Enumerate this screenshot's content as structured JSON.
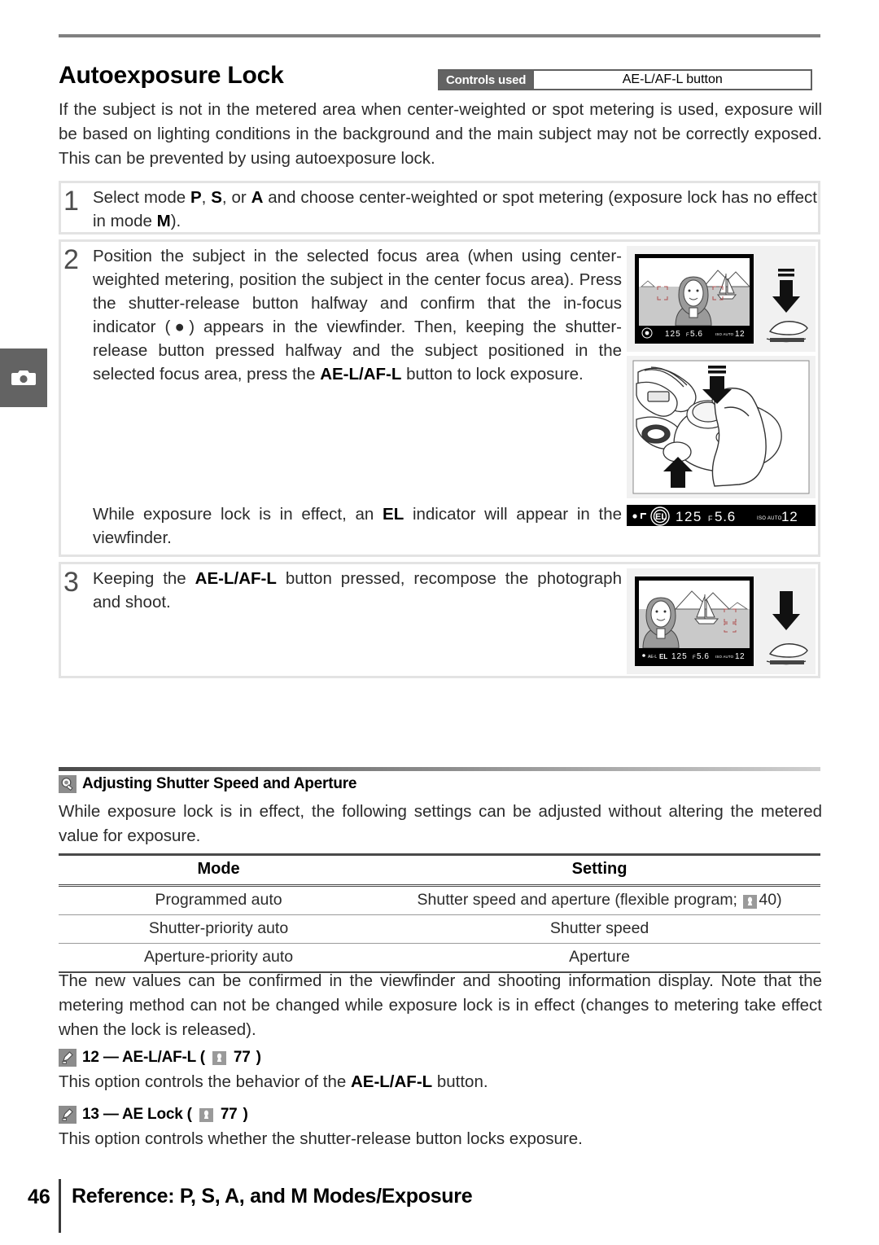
{
  "page": {
    "number": "46",
    "footer_title": "Reference: P, S, A, and M Modes/Exposure",
    "tab_icon": "camera-icon"
  },
  "header": {
    "title": "Autoexposure Lock",
    "controls_used_label": "Controls used",
    "controls_used_value": "AE-L/AF-L button"
  },
  "intro": "If the subject is not in the metered area when center-weighted or spot metering is used, exposure will be based on lighting conditions in the background and the main subject may not be correctly exposed.  This can be prevented by using autoexposure lock.",
  "steps": [
    {
      "number": "1",
      "text_parts": [
        {
          "t": "Select mode ",
          "b": false
        },
        {
          "t": "P",
          "b": true
        },
        {
          "t": ", ",
          "b": false
        },
        {
          "t": "S",
          "b": true
        },
        {
          "t": ", or ",
          "b": false
        },
        {
          "t": "A",
          "b": true
        },
        {
          "t": " and choose center-weighted or spot metering (exposure lock has no effect in mode ",
          "b": false
        },
        {
          "t": "M",
          "b": true
        },
        {
          "t": ").",
          "b": false
        }
      ]
    },
    {
      "number": "2",
      "text_parts": [
        {
          "t": "Position the subject in the selected focus area (when using center-weighted metering, position the subject in the center focus area).  Press the shutter-release button halfway and confirm that the in-focus indicator (●) appears in the viewfinder.  Then, keeping the shutter-release button pressed halfway and the subject positioned in the selected focus area, press the ",
          "b": false
        },
        {
          "t": "AE-L/AF-L",
          "b": true
        },
        {
          "t": " button to lock exposure.",
          "b": false
        }
      ],
      "text2_parts": [
        {
          "t": "While exposure lock is in effect, an ",
          "b": false
        },
        {
          "t": "EL",
          "b": true
        },
        {
          "t": " indicator will appear in the viewfinder.",
          "b": false
        }
      ]
    },
    {
      "number": "3",
      "text_parts": [
        {
          "t": "Keeping the ",
          "b": false
        },
        {
          "t": "AE-L/AF-L",
          "b": true
        },
        {
          "t": " button pressed, recompose the photograph and shoot.",
          "b": false
        }
      ]
    }
  ],
  "figures": {
    "viewfinder1": {
      "name": "viewfinder-centered-subject",
      "shutter_speed": "125",
      "aperture": "F5.6",
      "frames_remaining": "12",
      "iso_label": "ISO AUTO"
    },
    "camera_top": {
      "name": "camera-top-with-hand"
    },
    "viewfinder_strip": {
      "name": "viewfinder-el-indicator",
      "el_label": "EL",
      "shutter_speed": "125",
      "aperture": "F5.6",
      "iso_label": "ISO AUTO",
      "frames_remaining": "12"
    },
    "viewfinder2": {
      "name": "viewfinder-recomposed",
      "el_label": "EL",
      "shutter_speed": "125",
      "aperture": "F5.6",
      "frames_remaining": "12"
    }
  },
  "tip_section": {
    "icon": "magnifier-icon",
    "heading": "Adjusting Shutter Speed and Aperture",
    "body": "While exposure lock is in effect, the following settings can be adjusted without altering the metered value for exposure.",
    "table": {
      "headers": [
        "Mode",
        "Setting"
      ],
      "rows": [
        {
          "mode": "Programmed auto",
          "setting_pre": "Shutter speed and aperture (flexible program; ",
          "setting_ref": "40",
          "setting_post": ")"
        },
        {
          "mode": "Shutter-priority auto",
          "setting_pre": "Shutter speed",
          "setting_ref": "",
          "setting_post": ""
        },
        {
          "mode": "Aperture-priority auto",
          "setting_pre": "Aperture",
          "setting_ref": "",
          "setting_post": ""
        }
      ]
    },
    "after_table": "The new values can be confirmed in the viewfinder and shooting information display.  Note that the metering method can not be changed while exposure lock is in effect (changes to metering take effect when the lock is released)."
  },
  "custom_settings": [
    {
      "icon": "pencil-icon",
      "heading_pre": "12 — AE-L/AF-L (",
      "heading_ref": "77",
      "heading_post": ")",
      "body_parts": [
        {
          "t": "This option controls the behavior of the ",
          "b": false
        },
        {
          "t": "AE-L/AF-L",
          "b": true
        },
        {
          "t": " button.",
          "b": false
        }
      ]
    },
    {
      "icon": "pencil-icon",
      "heading_pre": "13 — AE Lock (",
      "heading_ref": "77",
      "heading_post": ")",
      "body_parts": [
        {
          "t": "This option controls whether the shutter-release button locks exposure.",
          "b": false
        }
      ]
    }
  ],
  "colors": {
    "tab_gray": "#636363",
    "rule_gray": "#808080",
    "box_border": "#e3e3e3",
    "text": "#2b2b2b"
  }
}
